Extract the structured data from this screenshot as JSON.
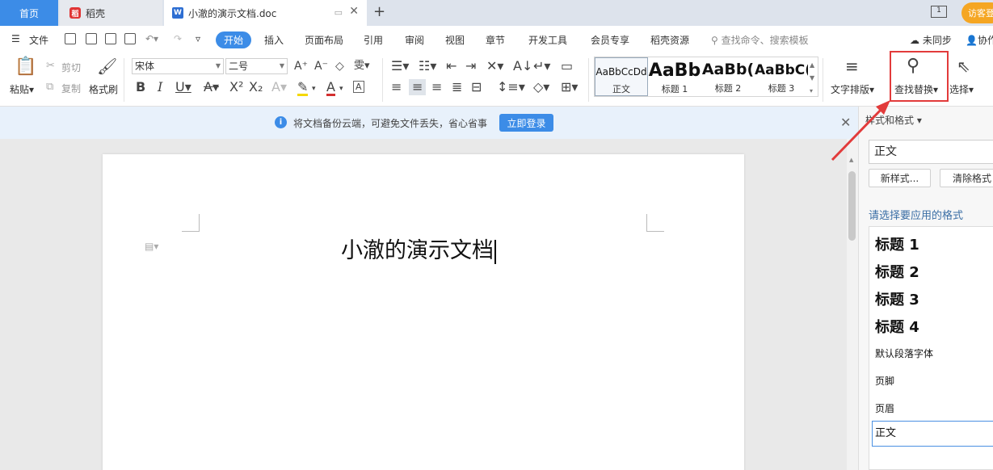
{
  "tabs": {
    "home": "首页",
    "daoke": "稻壳",
    "doc": "小澈的演示文档.doc",
    "visitor": "访客登"
  },
  "menu": {
    "file": "文件",
    "items": [
      "开始",
      "插入",
      "页面布局",
      "引用",
      "审阅",
      "视图",
      "章节",
      "开发工具",
      "会员专享",
      "稻壳资源"
    ],
    "search": "查找命令、搜索模板",
    "sync": "未同步",
    "collab": "协作"
  },
  "ribbon": {
    "paste": "粘贴",
    "cut": "剪切",
    "copy": "复制",
    "format_painter": "格式刷",
    "font_name": "宋体",
    "font_size": "二号",
    "styles": [
      {
        "preview": "AaBbCcDd",
        "label": "正文"
      },
      {
        "preview": "AaBb",
        "label": "标题 1"
      },
      {
        "preview": "AaBb(",
        "label": "标题 2"
      },
      {
        "preview": "AaBbC(",
        "label": "标题 3"
      }
    ],
    "text_layout": "文字排版",
    "find_replace": "查找替换",
    "select": "选择"
  },
  "notification": {
    "text": "将文档备份云端，可避免文件丢失，省心省事",
    "button": "立即登录"
  },
  "document": {
    "title": "小澈的演示文档"
  },
  "pane": {
    "title": "样式和格式",
    "current_style": "正文",
    "new_style": "新样式...",
    "clear_format": "清除格式",
    "apply_label": "请选择要应用的格式",
    "styles": [
      "标题 1",
      "标题 2",
      "标题 3",
      "标题 4",
      "默认段落字体",
      "页脚",
      "页眉",
      "正文"
    ]
  },
  "colors": {
    "accent": "#3c8ce7",
    "highlight_box": "#e23b3b",
    "visitor_badge": "#f5a623"
  }
}
